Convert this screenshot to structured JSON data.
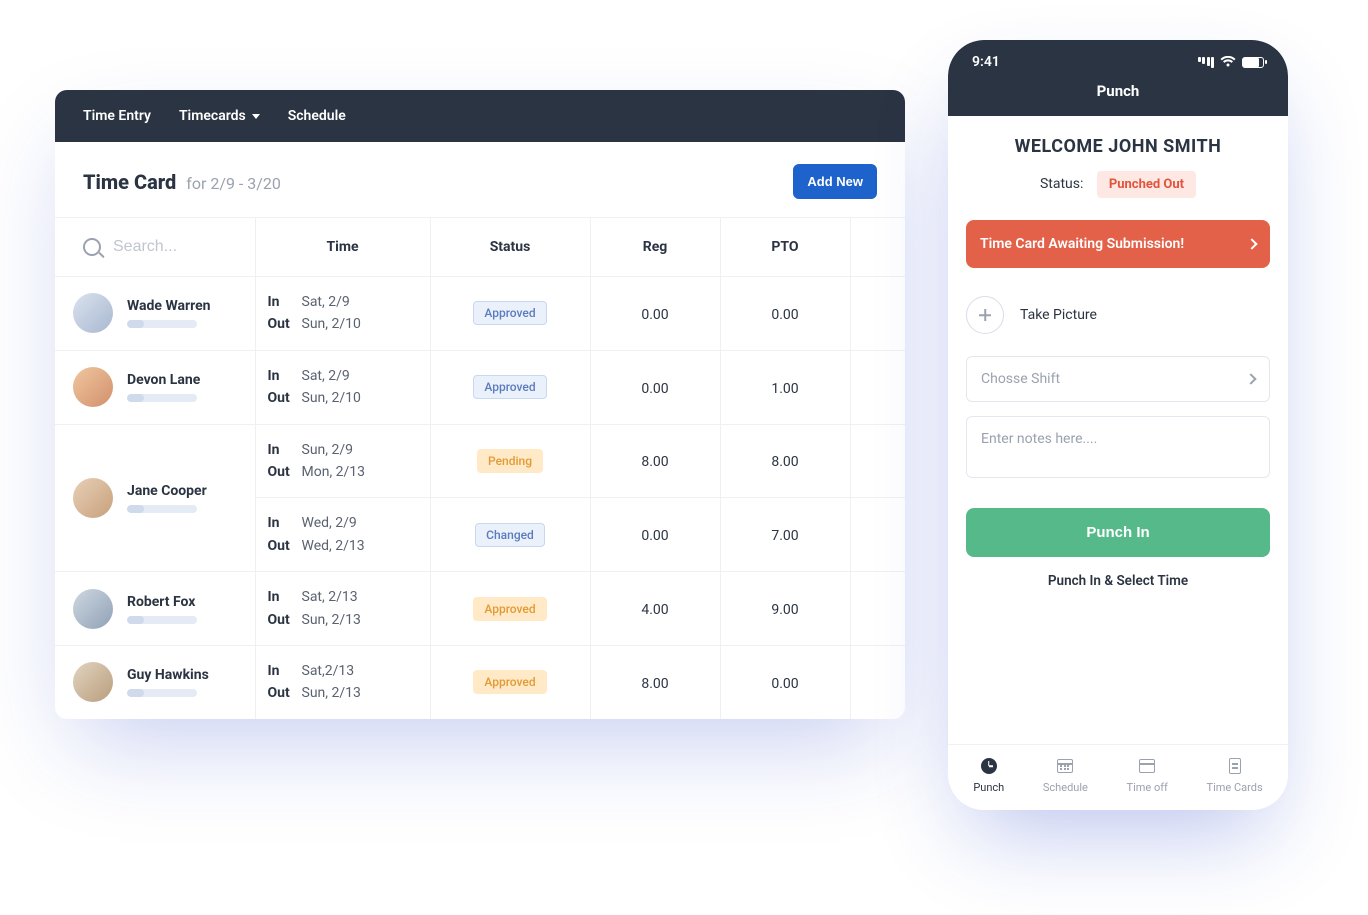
{
  "nav": {
    "time_entry": "Time Entry",
    "timecards": "Timecards",
    "schedule": "Schedule"
  },
  "header": {
    "title": "Time Card",
    "range": "for 2/9 - 3/20",
    "add_button": "Add New"
  },
  "table": {
    "search_placeholder": "Search...",
    "headers": {
      "time": "Time",
      "status": "Status",
      "reg": "Reg",
      "pto": "PTO"
    },
    "labels": {
      "in": "In",
      "out": "Out"
    },
    "people": [
      {
        "name": "Wade Warren",
        "avatar": "av1"
      },
      {
        "name": "Devon Lane",
        "avatar": "av2"
      },
      {
        "name": "Jane Cooper",
        "avatar": "av3"
      },
      {
        "name": "Robert Fox",
        "avatar": "av4"
      },
      {
        "name": "Guy Hawkins",
        "avatar": "av5"
      }
    ],
    "rows": [
      {
        "in": "Sat, 2/9",
        "out": "Sun, 2/10",
        "status": "Approved",
        "status_class": "badge-approved-blue",
        "reg": "0.00",
        "pto": "0.00"
      },
      {
        "in": "Sat, 2/9",
        "out": "Sun, 2/10",
        "status": "Approved",
        "status_class": "badge-approved-blue",
        "reg": "0.00",
        "pto": "1.00"
      },
      {
        "in": "Sun, 2/9",
        "out": "Mon, 2/13",
        "status": "Pending",
        "status_class": "badge-pending",
        "reg": "8.00",
        "pto": "8.00"
      },
      {
        "in": "Wed, 2/9",
        "out": "Wed, 2/13",
        "status": "Changed",
        "status_class": "badge-changed",
        "reg": "0.00",
        "pto": "7.00"
      },
      {
        "in": "Sat, 2/13",
        "out": "Sun, 2/13",
        "status": "Approved",
        "status_class": "badge-approved-amber",
        "reg": "4.00",
        "pto": "9.00"
      },
      {
        "in": "Sat,2/13",
        "out": "Sun, 2/13",
        "status": "Approved",
        "status_class": "badge-approved-amber",
        "reg": "8.00",
        "pto": "0.00"
      }
    ]
  },
  "phone": {
    "clock": "9:41",
    "title": "Punch",
    "welcome": "WELCOME JOHN SMITH",
    "status_label": "Status:",
    "status_value": "Punched Out",
    "alert": "Time Card Awaiting Submission!",
    "take_picture": "Take Picture",
    "choose_shift": "Chosse Shift",
    "notes_placeholder": "Enter notes here....",
    "punch_in": "Punch In",
    "punch_in_select": "Punch In & Select Time",
    "tabs": {
      "punch": "Punch",
      "schedule": "Schedule",
      "time_off": "Time off",
      "time_cards": "Time Cards"
    }
  }
}
